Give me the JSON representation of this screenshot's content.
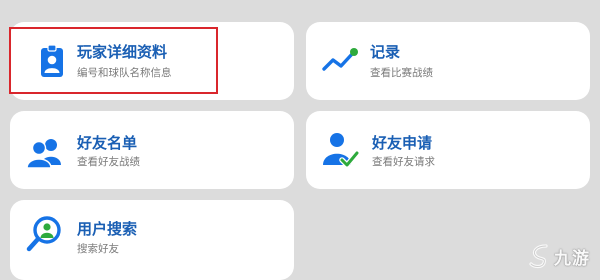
{
  "menu": {
    "items": [
      {
        "id": "player",
        "title": "玩家详细资料",
        "subtitle": "编号和球队名称信息",
        "icon": "id-badge-icon"
      },
      {
        "id": "record",
        "title": "记录",
        "subtitle": "查看比赛战绩",
        "icon": "trend-line-icon"
      },
      {
        "id": "friends",
        "title": "好友名单",
        "subtitle": "查看好友战绩",
        "icon": "two-users-icon"
      },
      {
        "id": "friend-request",
        "title": "好友申请",
        "subtitle": "查看好友请求",
        "icon": "user-check-icon"
      },
      {
        "id": "user-search",
        "title": "用户搜索",
        "subtitle": "搜索好友",
        "icon": "magnifier-user-icon"
      }
    ]
  },
  "watermark": {
    "text": "九游"
  },
  "colors": {
    "accent": "#1a5fb4",
    "icon_blue": "#1673e6",
    "check_green": "#2eaa3c",
    "highlight_red": "#d9262c",
    "background": "#dcdcdc"
  }
}
